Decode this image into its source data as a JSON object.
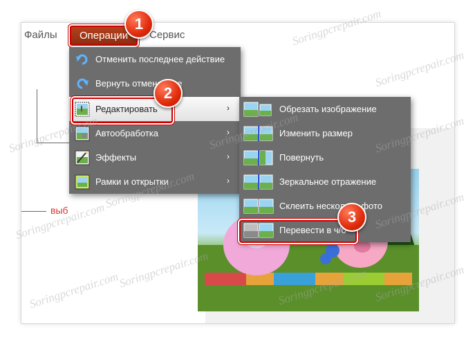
{
  "menubar": {
    "files": "Файлы",
    "operations": "Операции",
    "service": "Сервис"
  },
  "background": {
    "red_label": "выб"
  },
  "menu": {
    "items": [
      {
        "label": "Отменить последнее действие",
        "icon": "undo-icon"
      },
      {
        "label": "Вернуть отмененное",
        "icon": "redo-icon"
      },
      {
        "label": "Редактировать",
        "icon": "edit-photo-icon",
        "submenu": true
      },
      {
        "label": "Автообработка",
        "icon": "auto-process-icon",
        "submenu": true
      },
      {
        "label": "Эффекты",
        "icon": "effects-icon",
        "submenu": true
      },
      {
        "label": "Рамки и открытки",
        "icon": "frames-icon",
        "submenu": true
      }
    ],
    "arrow": "›"
  },
  "submenu": {
    "items": [
      {
        "label": "Обрезать изображение",
        "icon": "crop-icon"
      },
      {
        "label": "Изменить размер",
        "icon": "resize-icon"
      },
      {
        "label": "Повернуть",
        "icon": "rotate-icon"
      },
      {
        "label": "Зеркальное отражение",
        "icon": "mirror-icon"
      },
      {
        "label": "Склеить несколько фото",
        "icon": "merge-icon"
      },
      {
        "label": "Перевести в ч/б",
        "icon": "grayscale-icon"
      }
    ]
  },
  "badges": [
    "1",
    "2",
    "3"
  ],
  "watermark": "Soringpcrepair.com",
  "colors": {
    "menu_bg": "#6d6d6d",
    "active_menu": "#a63a18",
    "highlight_border": "#cc0000"
  }
}
